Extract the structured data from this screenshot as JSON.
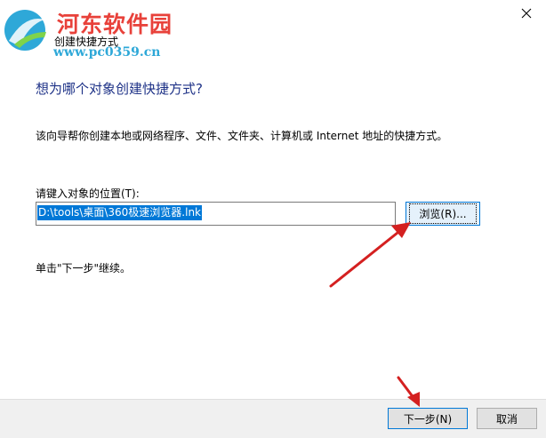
{
  "watermark": {
    "site_name": "河东软件园",
    "site_url": "www.pc0359.cn"
  },
  "window": {
    "title": "创建快捷方式",
    "close_icon": "close-icon"
  },
  "page": {
    "heading": "想为哪个对象创建快捷方式?",
    "description": "该向导帮你创建本地或网络程序、文件、文件夹、计算机或 Internet 地址的快捷方式。",
    "location_label": "请键入对象的位置(T):",
    "location_value": "D:\\tools\\桌面\\360极速浏览器.lnk",
    "browse_label": "浏览(R)...",
    "hint": "单击\"下一步\"继续。"
  },
  "footer": {
    "next_label": "下一步(N)",
    "cancel_label": "取消"
  },
  "colors": {
    "heading": "#1e3287",
    "selection": "#0078d7",
    "annotation_arrow": "#d42020",
    "watermark_red": "#e8413a",
    "watermark_blue": "#2ea8d8"
  }
}
